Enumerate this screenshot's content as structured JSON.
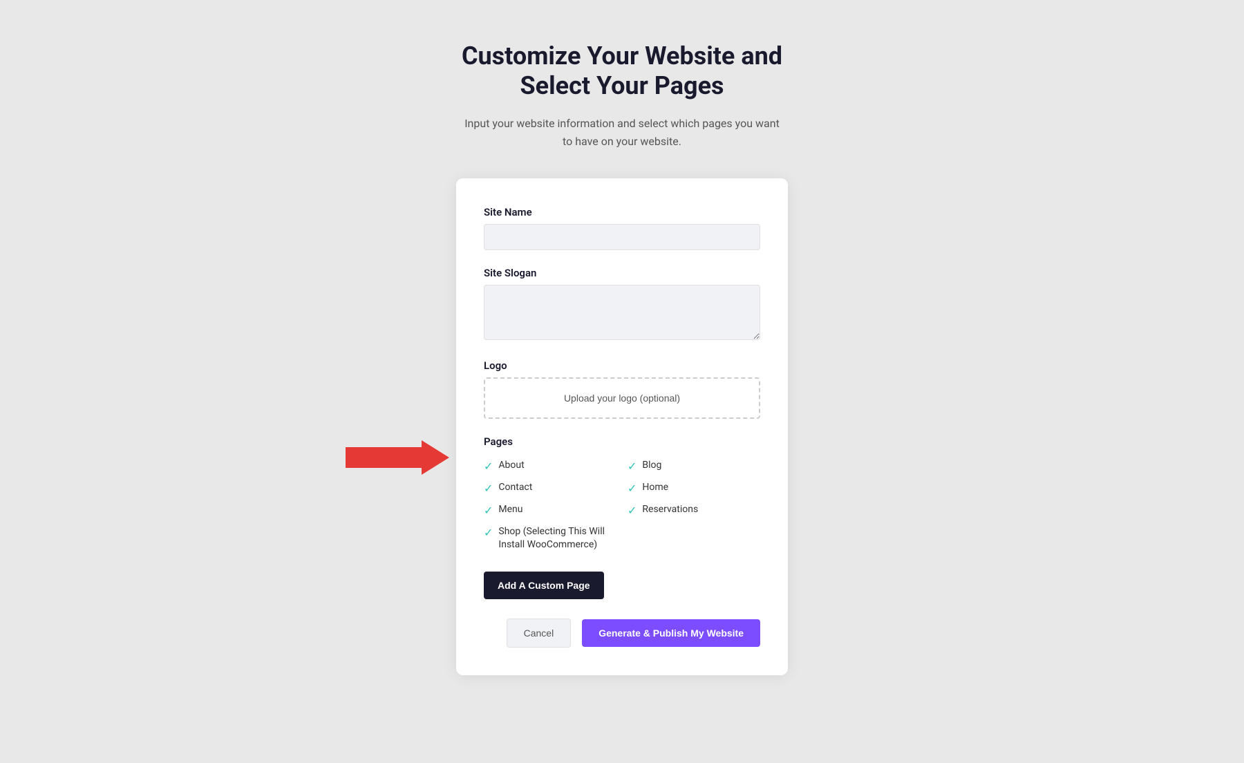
{
  "page": {
    "title_line1": "Customize Your Website and",
    "title_line2": "Select Your Pages",
    "subtitle": "Input your website information and select which pages you want to have on your website."
  },
  "form": {
    "site_name_label": "Site Name",
    "site_name_placeholder": "",
    "site_slogan_label": "Site Slogan",
    "site_slogan_placeholder": "",
    "logo_label": "Logo",
    "logo_upload_text": "Upload your logo (optional)",
    "pages_label": "Pages",
    "pages": [
      {
        "id": "about",
        "label": "About",
        "checked": true,
        "col": 1
      },
      {
        "id": "blog",
        "label": "Blog",
        "checked": true,
        "col": 2
      },
      {
        "id": "contact",
        "label": "Contact",
        "checked": true,
        "col": 1
      },
      {
        "id": "home",
        "label": "Home",
        "checked": true,
        "col": 2
      },
      {
        "id": "menu",
        "label": "Menu",
        "checked": true,
        "col": 1
      },
      {
        "id": "reservations",
        "label": "Reservations",
        "checked": true,
        "col": 2
      },
      {
        "id": "shop",
        "label": "Shop (Selecting This Will Install WooCommerce)",
        "checked": true,
        "col": 1
      }
    ],
    "add_custom_page_label": "Add A Custom Page",
    "cancel_label": "Cancel",
    "publish_label": "Generate & Publish My Website"
  }
}
